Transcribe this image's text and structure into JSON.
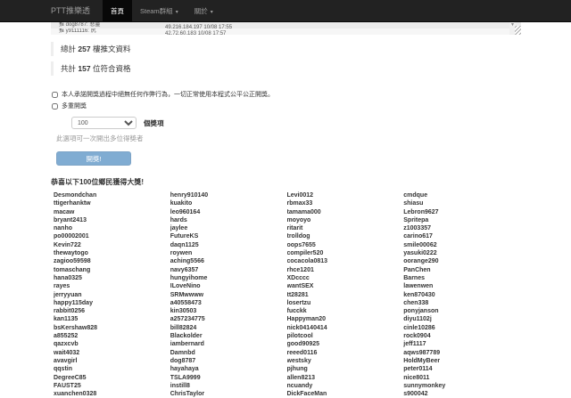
{
  "navbar": {
    "brand": "PTT推樂透",
    "items": [
      {
        "key": "home",
        "label": "首頁",
        "active": true,
        "caret": false
      },
      {
        "key": "steam-group",
        "label": "Steam群組",
        "active": false,
        "caret": true
      },
      {
        "key": "about",
        "label": "關於",
        "active": false,
        "caret": true
      }
    ]
  },
  "icons": {
    "caret_down": "▾",
    "scroll_down": "▼"
  },
  "push_list": {
    "rows": [
      {
        "text": "推 dog8787: 悲靈",
        "meta": "49.216.184.197 10/08 17:55"
      },
      {
        "text": "推 y9111116: 尻",
        "meta": "42.72.60.183 10/08 17:57"
      }
    ]
  },
  "totals": {
    "push_prefix": "總計",
    "push_count": "257",
    "push_suffix": " 樓推文資料",
    "qualified_prefix": "共計",
    "qualified_count": "157",
    "qualified_suffix": " 位符合資格"
  },
  "form": {
    "promise_label": "本人承諾開獎過程中絕無任何作弊行為，一切正常使用本程式公平公正開獎。",
    "multi_label": "多重開獎",
    "prize_count_value": "100",
    "prize_label": "個獎項",
    "multi_help": "此選項可一次開出多位得獎者",
    "draw_button": "開獎!"
  },
  "results": {
    "header": "恭喜以下100位鄉民獲得大獎!",
    "columns": [
      [
        "Desmondchan",
        "ttigerhanktw",
        "macaw",
        "bryant2413",
        "nanho",
        "po00002001",
        "Kevin722",
        "thewaytogo",
        "zagioo59598",
        "tomaschang",
        "hana0325",
        "rayes",
        "jerryyuan",
        "happy115day",
        "rabbit0256",
        "kan1135",
        "bsKershaw828",
        "a855252",
        "qazxcvb",
        "wait4032",
        "avavgirl",
        "qqstin",
        "DegreeC85",
        "FAUST25",
        "xuanchen0328"
      ],
      [
        "henry910140",
        "kuakito",
        "leo960164",
        "hards",
        "jaylee",
        "FutureKS",
        "daqn1125",
        "roywen",
        "aching5566",
        "navy6357",
        "hungyihome",
        "ILoveNino",
        "SRMwwww",
        "a40558473",
        "kin30503",
        "a257234775",
        "bill82824",
        "Blackolder",
        "iambernard",
        "Damnbd",
        "dog8787",
        "hayahaya",
        "TSLA9999",
        "instill8",
        "ChrisTaylor"
      ],
      [
        "Levi0012",
        "rbmax33",
        "tamama000",
        "moyoyo",
        "ritarit",
        "trolldog",
        "oops7655",
        "compiler520",
        "cocacola0813",
        "rhce1201",
        "XDcccc",
        "wantSEX",
        "tt28281",
        "losertzu",
        "fucckk",
        "Happyman20",
        "nick04140414",
        "pilotcool",
        "good90925",
        "reeed0116",
        "westsky",
        "pjhung",
        "allen8213",
        "ncuandy",
        "DickFaceMan"
      ],
      [
        "cmdque",
        "shiasu",
        "Lebron9627",
        "Spritepa",
        "z1003357",
        "carino617",
        "smile00062",
        "yasuki0222",
        "oorange290",
        "PanChen",
        "Barnes",
        "lawenwen",
        "ken870430",
        "chen338",
        "ponyjanson",
        "diyu1102j",
        "cinle10286",
        "rock0904",
        "jeff1117",
        "aqws987789",
        "HoldMyBeer",
        "peter0114",
        "nice8011",
        "sunnymonkey",
        "s900042"
      ]
    ]
  },
  "colors": {
    "navbar_bg": "#222222",
    "navbar_active_bg": "#080808",
    "navbar_link": "#9d9d9d",
    "button_primary": "#337ab7",
    "text": "#333333",
    "muted": "#999999",
    "stripe": "#ececec"
  }
}
